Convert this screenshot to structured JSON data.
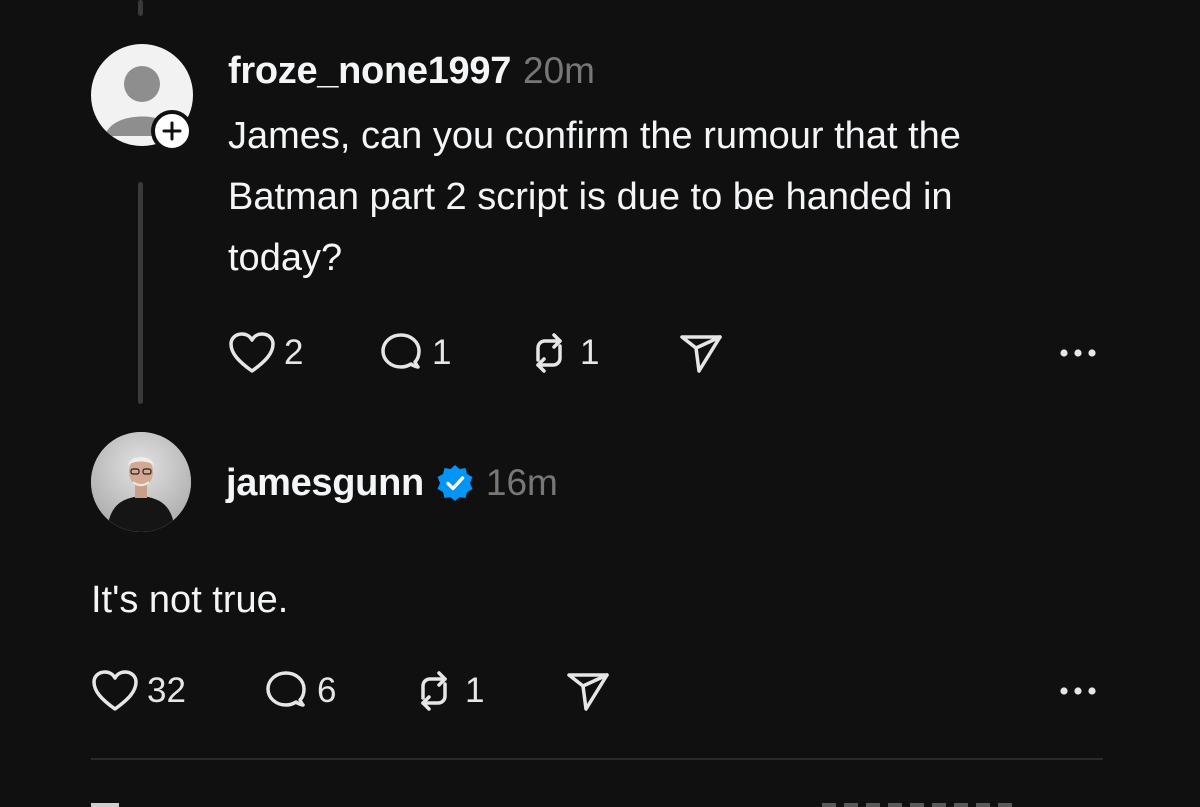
{
  "reply": {
    "username": "froze_none1997",
    "time": "20m",
    "text_lines": [
      "James, can you confirm the rumour that the",
      "Batman part 2 script is due to be handed in",
      "today?"
    ],
    "likes": "2",
    "comments": "1",
    "reposts": "1",
    "avatar_icon": "default-user-avatar-icon",
    "follow_icon": "plus-icon"
  },
  "answer": {
    "username": "jamesgunn",
    "verified_icon": "verified-badge-icon",
    "time": "16m",
    "text": "It's not true.",
    "likes": "32",
    "comments": "6",
    "reposts": "1"
  },
  "colors": {
    "background": "#101010",
    "text": "#f3f5f7",
    "muted": "#777777",
    "verified": "#0095f6",
    "thread_line": "#3a3a3a"
  }
}
